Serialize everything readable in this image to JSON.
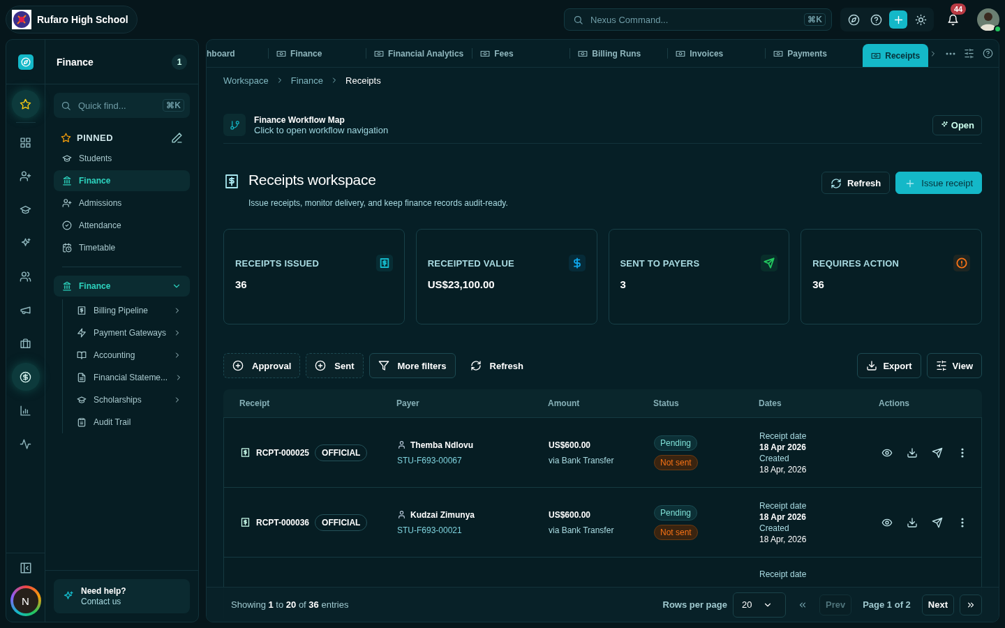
{
  "header": {
    "school_name": "Rufaro High School",
    "search": {
      "placeholder": "Nexus Command...",
      "shortcut": "⌘K"
    },
    "notification_count": "44"
  },
  "rail": {
    "items": [
      {
        "selected": true
      },
      {
        "selected": false
      },
      {
        "selected": false
      },
      {
        "selected": false
      },
      {
        "selected": false
      },
      {
        "selected": false
      },
      {
        "selected": false
      },
      {
        "selected": false
      },
      {
        "selected": true
      },
      {
        "selected": false
      },
      {
        "selected": false
      }
    ],
    "avatar_initial": "N"
  },
  "panel": {
    "title": "Finance",
    "badge": "1",
    "quick_find": {
      "placeholder": "Quick find...",
      "shortcut": "⌘K"
    },
    "pinned": {
      "label": "PINNED",
      "items": [
        {
          "label": "Students",
          "selected": false
        },
        {
          "label": "Finance",
          "selected": true
        },
        {
          "label": "Admissions",
          "selected": false
        },
        {
          "label": "Attendance",
          "selected": false
        },
        {
          "label": "Timetable",
          "selected": false
        }
      ]
    },
    "section": {
      "label": "Finance",
      "expanded": true,
      "children": [
        {
          "label": "Billing Pipeline",
          "has_submenu": true
        },
        {
          "label": "Payment Gateways",
          "has_submenu": true
        },
        {
          "label": "Accounting",
          "has_submenu": true
        },
        {
          "label": "Financial Stateme...",
          "has_submenu": true
        },
        {
          "label": "Scholarships",
          "has_submenu": true
        },
        {
          "label": "Audit Trail",
          "has_submenu": false
        }
      ]
    },
    "help": {
      "title": "Need help?",
      "link": "Contact us"
    }
  },
  "tabs": [
    {
      "label": "hboard",
      "selected": false
    },
    {
      "label": "Finance",
      "selected": false
    },
    {
      "label": "Financial Analytics",
      "selected": false
    },
    {
      "label": "Fees",
      "selected": false
    },
    {
      "label": "Billing Runs",
      "selected": false
    },
    {
      "label": "Invoices",
      "selected": false
    },
    {
      "label": "Payments",
      "selected": false
    },
    {
      "label": "Receipts",
      "selected": true
    }
  ],
  "breadcrumb": [
    "Workspace",
    "Finance",
    "Receipts"
  ],
  "workflow": {
    "title": "Finance Workflow Map",
    "subtitle": "Click to open workflow navigation",
    "button": "Open"
  },
  "page": {
    "title": "Receipts workspace",
    "subtitle": "Issue receipts, monitor delivery, and keep finance records audit-ready.",
    "buttons": [
      {
        "label": "Refresh",
        "kind": "secondary"
      },
      {
        "label": "Issue receipt",
        "kind": "primary"
      }
    ]
  },
  "stats": [
    {
      "label": "RECEIPTS ISSUED",
      "value": "36",
      "color": "#14b8c8"
    },
    {
      "label": "RECEIPTED VALUE",
      "value": "US$23,100.00",
      "color": "#0ea5e9"
    },
    {
      "label": "SENT TO PAYERS",
      "value": "3",
      "color": "#22c55e"
    },
    {
      "label": "REQUIRES ACTION",
      "value": "36",
      "color": "#f97316"
    }
  ],
  "filters": [
    {
      "label": "Approval",
      "kind": "facet"
    },
    {
      "label": "Sent",
      "kind": "facet"
    },
    {
      "label": "More filters",
      "kind": "menu"
    },
    {
      "label": "Refresh",
      "kind": "action"
    }
  ],
  "table_actions": [
    "Export",
    "View"
  ],
  "table": {
    "columns": [
      "Receipt",
      "Payer",
      "Amount",
      "Status",
      "Dates",
      "Actions"
    ],
    "rows": [
      {
        "receipt": "RCPT-000025",
        "type": "OFFICIAL",
        "payer_name": "Themba Ndlovu",
        "payer_id": "STU-F693-00067",
        "amount": "US$600.00",
        "method": "via Bank Transfer",
        "status": "Pending",
        "delivery": "Not sent",
        "receipt_date_label": "Receipt date",
        "receipt_date": "18 Apr 2026",
        "created_label": "Created",
        "created": "18 Apr, 2026"
      },
      {
        "receipt": "RCPT-000036",
        "type": "OFFICIAL",
        "payer_name": "Kudzai Zimunya",
        "payer_id": "STU-F693-00021",
        "amount": "US$600.00",
        "method": "via Bank Transfer",
        "status": "Pending",
        "delivery": "Not sent",
        "receipt_date_label": "Receipt date",
        "receipt_date": "18 Apr 2026",
        "created_label": "Created",
        "created": "18 Apr, 2026"
      },
      {
        "receipt_date_label": "Receipt date"
      }
    ]
  },
  "footer": {
    "showing": "Showing **1** to **20** of **36** entries",
    "rows_per_page_label": "Rows per page",
    "rows_per_page": "20",
    "prev": {
      "label": "Prev",
      "disabled": true
    },
    "page": "Page 1 of 2",
    "next": {
      "label": "Next",
      "disabled": false
    }
  }
}
